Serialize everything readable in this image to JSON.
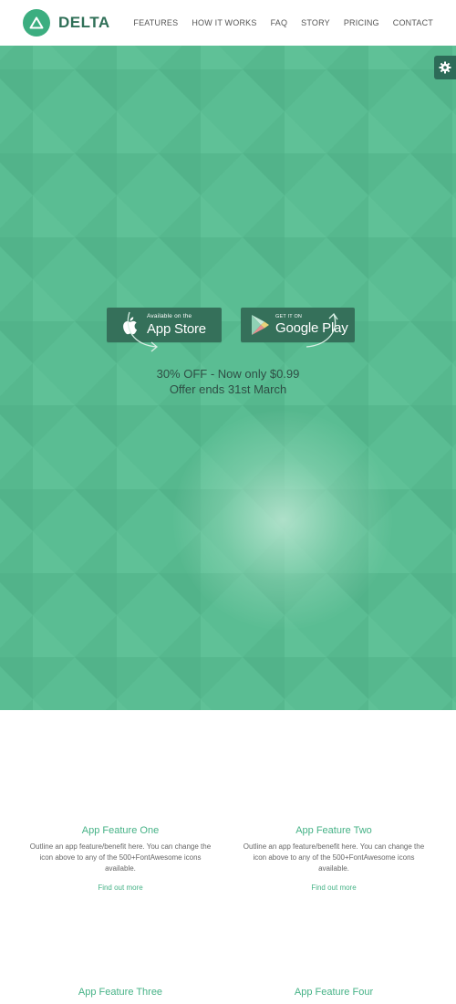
{
  "header": {
    "brand": "DELTA",
    "nav": [
      "FEATURES",
      "HOW IT WORKS",
      "FAQ",
      "STORY",
      "PRICING",
      "CONTACT"
    ]
  },
  "hero": {
    "apple": {
      "small": "Available on the",
      "big": "App Store"
    },
    "google": {
      "small": "GET IT ON",
      "big": "Google Play"
    },
    "offer_line1": "30% OFF - Now only $0.99",
    "offer_line2": "Offer ends 31st March"
  },
  "features": [
    {
      "title": "App Feature One",
      "description": "Outline an app feature/benefit here. You can change the icon above to any of the 500+FontAwesome icons available.",
      "link": "Find out more"
    },
    {
      "title": "App Feature Two",
      "description": "Outline an app feature/benefit here. You can change the icon above to any of the 500+FontAwesome icons available.",
      "link": "Find out more"
    },
    {
      "title": "App Feature Three"
    },
    {
      "title": "App Feature Four"
    }
  ],
  "icons": {
    "logo": "triangle-logo-icon",
    "settings": "gear-icon",
    "apple": "apple-icon",
    "google": "google-play-icon",
    "arrows": "curved-arrow-icon"
  },
  "colors": {
    "brand_green": "#3cae80",
    "hero_bg": "#5abd93",
    "button_bg": "#35705a",
    "link_green": "#45b286",
    "settings_bg": "#2d6b58"
  }
}
